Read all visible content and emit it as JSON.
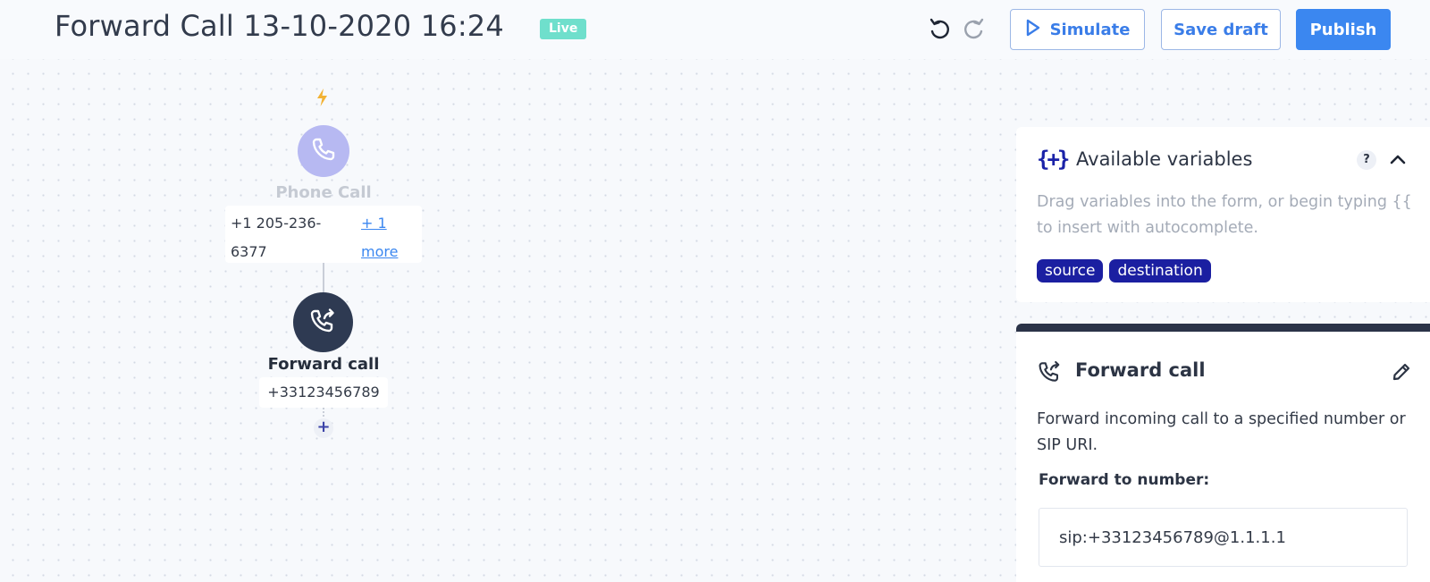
{
  "header": {
    "title": "Forward Call 13-10-2020 16:24",
    "status_badge": "Live",
    "simulate_label": "Simulate",
    "save_draft_label": "Save draft",
    "publish_label": "Publish"
  },
  "flow": {
    "trigger": {
      "label": "Phone Call",
      "number": "+1 205-236-6377",
      "more_link": "+ 1 more"
    },
    "action": {
      "label": "Forward call",
      "value": "+33123456789"
    },
    "add_symbol": "+"
  },
  "variables_panel": {
    "icon_text": "{+}",
    "title": "Available variables",
    "help": "?",
    "description": "Drag variables into the form, or begin typing {{ to insert with autocomplete.",
    "chips": [
      "source",
      "destination"
    ]
  },
  "forward_panel": {
    "title": "Forward call",
    "description": "Forward incoming call to a specified number or SIP URI.",
    "field_label": "Forward to number:",
    "field_value": "sip:+33123456789@1.1.1.1"
  },
  "colors": {
    "accent": "#3b87f0",
    "live": "#6fdfcc",
    "trigger_node": "#b7b9f2",
    "action_node": "#2e3a52",
    "chip": "#1b1fa1",
    "bolt": "#f2b234"
  }
}
